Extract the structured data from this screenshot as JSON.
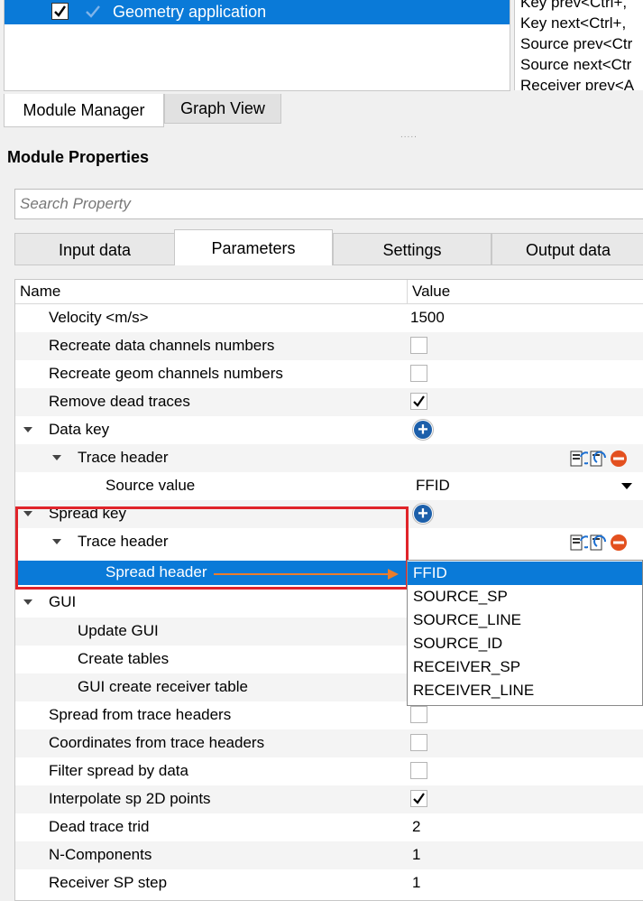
{
  "top_list": {
    "selected_item": "Geometry application"
  },
  "shortcuts": [
    "Key prev<Ctrl+,",
    "Key next<Ctrl+,",
    "Source prev<Ctr",
    "Source next<Ctr",
    "Receiver prev<A"
  ],
  "bottom_tabs": [
    "Module Manager",
    "Graph View"
  ],
  "section_title": "Module Properties",
  "search": {
    "placeholder": "Search Property"
  },
  "property_tabs": [
    "Input data",
    "Parameters",
    "Settings",
    "Output data"
  ],
  "active_property_tab": "Parameters",
  "grid": {
    "col_name": "Name",
    "col_value": "Value",
    "rows": {
      "velocity": {
        "name": "Velocity <m/s>",
        "value": "1500"
      },
      "recreate_data": {
        "name": "Recreate data channels numbers",
        "checked": false
      },
      "recreate_geom": {
        "name": "Recreate geom channels numbers",
        "checked": false
      },
      "remove_dead": {
        "name": "Remove dead traces",
        "checked": true
      },
      "data_key": {
        "name": "Data key"
      },
      "data_trace_header": {
        "name": "Trace header"
      },
      "source_value": {
        "name": "Source value",
        "value": "FFID"
      },
      "spread_key": {
        "name": "Spread key"
      },
      "spread_trace_header": {
        "name": "Trace header"
      },
      "spread_header": {
        "name": "Spread header"
      },
      "gui": {
        "name": "GUI"
      },
      "update_gui": {
        "name": "Update GUI"
      },
      "create_tables": {
        "name": "Create tables"
      },
      "gui_receiver_table": {
        "name": "GUI create receiver table"
      },
      "spread_from_headers": {
        "name": "Spread from trace headers",
        "checked": false
      },
      "coords_from_headers": {
        "name": "Coordinates from trace headers",
        "checked": false
      },
      "filter_spread": {
        "name": "Filter spread by data",
        "checked": false
      },
      "interpolate_sp": {
        "name": "Interpolate sp 2D points",
        "checked": true
      },
      "dead_trace_trid": {
        "name": "Dead trace trid",
        "value": "2"
      },
      "n_components": {
        "name": "N-Components",
        "value": "1"
      },
      "receiver_sp_step": {
        "name": "Receiver SP step",
        "value": "1"
      }
    }
  },
  "dropdown": {
    "options": [
      "FFID",
      "SOURCE_SP",
      "SOURCE_LINE",
      "SOURCE_ID",
      "RECEIVER_SP",
      "RECEIVER_LINE"
    ],
    "selected": "FFID"
  },
  "colors": {
    "selection": "#0a7ad8",
    "highlight_box": "#e0242a",
    "annotation_arrow": "#ea7d2c",
    "add_button": "#1c5faa"
  }
}
